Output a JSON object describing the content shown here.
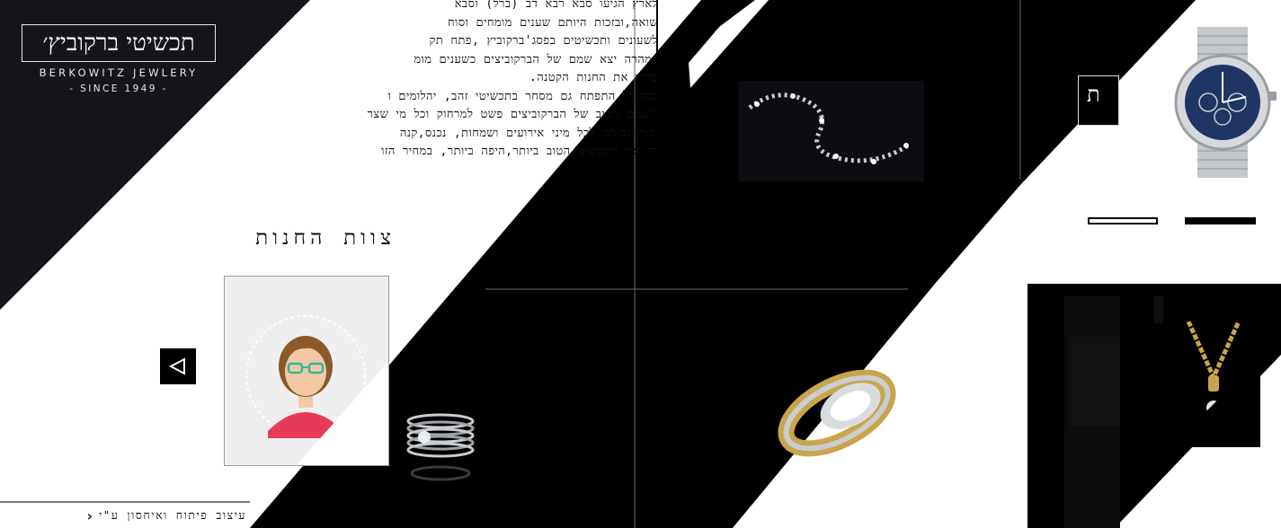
{
  "brand": {
    "logo_he": "תכשיטי ברקוביץ׳",
    "name_en": "BERKOWITZ JEWLERY",
    "since": "- SINCE 1949 -"
  },
  "about": {
    "lines": [
      "לארץ הגיעו סבא רבא דב (ברל) וסבא",
      "שואה,ובזכות היותם שענים מומחים וסוח",
      "לשעונים ותכשיטים בפסג'ברקוביץ ,פתח תק",
      "במהרה יצא שמם של הברקוביצים כשענים מומ",
      "פקדו את החנות הקטנה.",
      "במקביל התפתח גם מסחר בתכשיטי זהב, יהלומים ו",
      "'שמם הטוב של הברקוביצים פשט למרחוק וכל מי שצר",
      "יכות גבוהה לכל מיני אירועים ושמחות, נכנס,קנה",
      "יה את התכשיט הטוב ביותר,היפה ביותר, במחיר הזו"
    ]
  },
  "team": {
    "title": "צוות החנות"
  },
  "footer": {
    "credit": "עיצוב פיתוח ואיחסון ע\"י"
  },
  "mini_logo": {
    "text": "ת"
  },
  "icons": {
    "prev": "triangle-left-icon",
    "credit_arrow": "chevron-left-icon"
  },
  "colors": {
    "black": "#000000",
    "white": "#ffffff",
    "logo_panel": "#16161a",
    "gold": "#c8a54a",
    "silver": "#c9ccd0",
    "watch_dial": "#1f3563",
    "avatar_skin": "#f3c9a5",
    "avatar_hair": "#8a5a2b",
    "avatar_shirt": "#e63b57",
    "avatar_glasses": "#2fb79b"
  }
}
